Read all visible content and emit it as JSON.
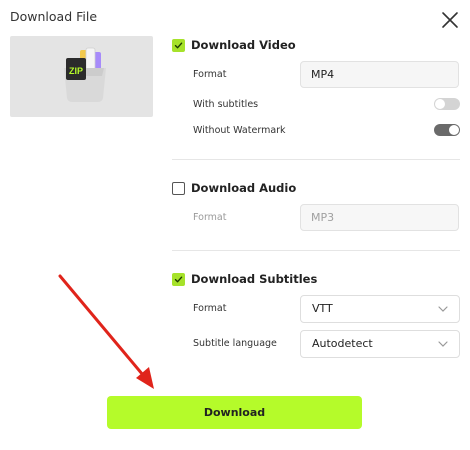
{
  "dialog": {
    "title": "Download File",
    "close_icon": "close-icon"
  },
  "thumbnail": {
    "icon": "zip-archive-icon",
    "icon_text": "ZIP"
  },
  "video": {
    "label": "Download Video",
    "checked": true,
    "format_label": "Format",
    "format_value": "MP4",
    "subtitles_label": "With subtitles",
    "subtitles_on": false,
    "watermark_label": "Without Watermark",
    "watermark_on": true
  },
  "audio": {
    "label": "Download Audio",
    "checked": false,
    "format_label": "Format",
    "format_value": "MP3"
  },
  "subtitles": {
    "label": "Download Subtitles",
    "checked": true,
    "format_label": "Format",
    "format_value": "VTT",
    "language_label": "Subtitle language",
    "language_value": "Autodetect"
  },
  "download_button": {
    "label": "Download"
  },
  "colors": {
    "accent": "#b5fb2a",
    "checkbox": "#a6e22a",
    "annotation_arrow": "#e0241b"
  }
}
